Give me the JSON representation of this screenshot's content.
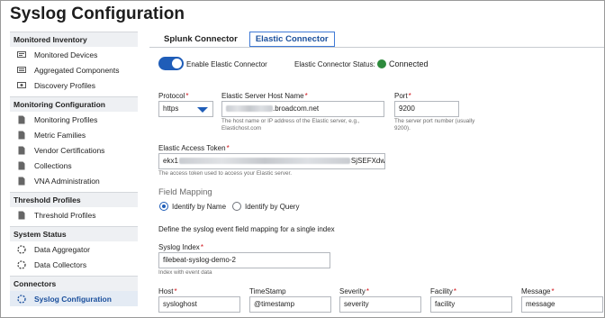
{
  "page": {
    "title": "Syslog Configuration"
  },
  "sidebar": {
    "sections": [
      {
        "header": "Monitored Inventory",
        "items": [
          "Monitored Devices",
          "Aggregated Components",
          "Discovery Profiles"
        ]
      },
      {
        "header": "Monitoring Configuration",
        "items": [
          "Monitoring Profiles",
          "Metric Families",
          "Vendor Certifications",
          "Collections",
          "VNA Administration"
        ]
      },
      {
        "header": "Threshold Profiles",
        "items": [
          "Threshold Profiles"
        ]
      },
      {
        "header": "System Status",
        "items": [
          "Data Aggregator",
          "Data Collectors"
        ]
      },
      {
        "header": "Connectors",
        "items": [
          "Syslog Configuration"
        ]
      }
    ]
  },
  "tabs": [
    "Splunk Connector",
    "Elastic Connector"
  ],
  "active_tab": "Elastic Connector",
  "connector": {
    "enable_label": "Enable Elastic Connector",
    "enabled": true,
    "status_label": "Elastic Connector Status:",
    "status_value": "Connected",
    "status_color": "#2d8a3c"
  },
  "form": {
    "protocol": {
      "label": "Protocol",
      "value": "https"
    },
    "host_name": {
      "label": "Elastic Server Host Name",
      "value_suffix": ".broadcom.net",
      "help": "The host name or IP address of the Elastic server, e.g., Elastichost.com"
    },
    "port": {
      "label": "Port",
      "value": "9200",
      "help": "The server port number (usually 9200)."
    },
    "access_token": {
      "label": "Elastic Access Token",
      "value_prefix": "ekx1",
      "value_suffix": "SjSEFXdw=",
      "help": "The access token used to access your Elastic server."
    },
    "field_mapping": {
      "title": "Field Mapping",
      "options": [
        "Identify by Name",
        "Identify by Query"
      ],
      "selected": "Identify by Name",
      "description": "Define the syslog event field mapping for a single index"
    },
    "syslog_index": {
      "label": "Syslog Index",
      "value": "filebeat-syslog-demo-2",
      "help": "Index with event data"
    },
    "mapping_fields": [
      {
        "label": "Host",
        "value": "sysloghost"
      },
      {
        "label": "TimeStamp",
        "value": "@timestamp"
      },
      {
        "label": "Severity",
        "value": "severity"
      },
      {
        "label": "Facility",
        "value": "facility"
      },
      {
        "label": "Message",
        "value": "message"
      }
    ]
  }
}
